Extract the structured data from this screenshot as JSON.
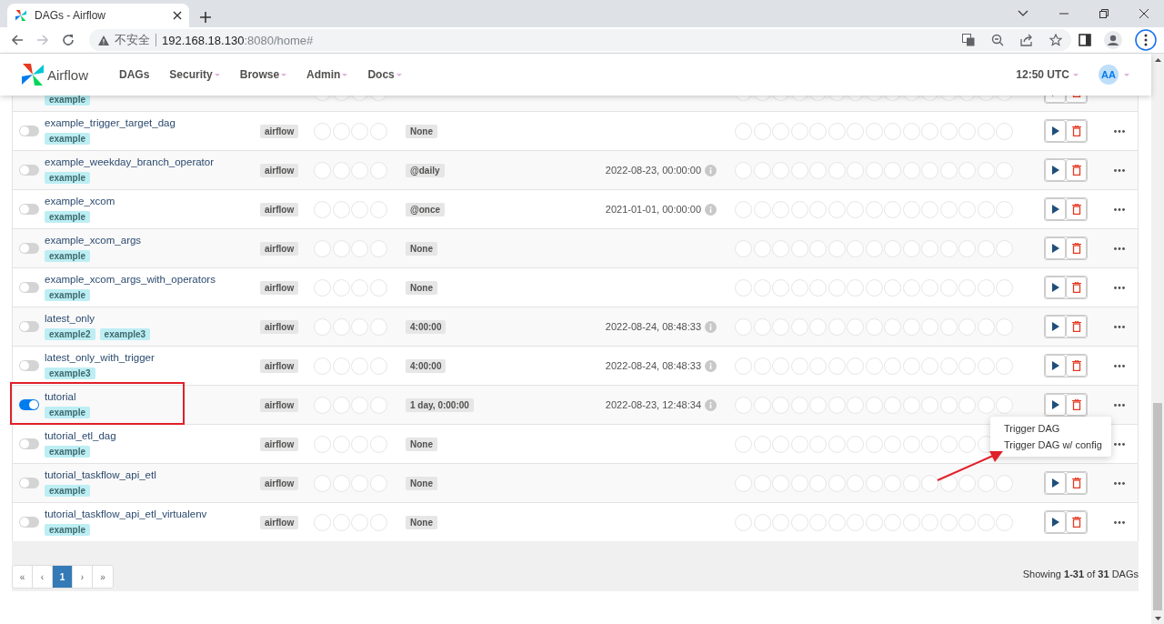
{
  "browser": {
    "tab_title": "DAGs - Airflow",
    "security_label": "不安全",
    "url_host": "192.168.18.130",
    "url_rest": ":8080/home#"
  },
  "navbar": {
    "brand": "Airflow",
    "menu": [
      {
        "label": "DAGs",
        "dropdown": false
      },
      {
        "label": "Security",
        "dropdown": true
      },
      {
        "label": "Browse",
        "dropdown": true
      },
      {
        "label": "Admin",
        "dropdown": true
      },
      {
        "label": "Docs",
        "dropdown": true
      }
    ],
    "time": "12:50 UTC",
    "user_initials": "AA"
  },
  "dags": [
    {
      "tags": [
        "example"
      ]
    },
    {
      "name": "example_trigger_target_dag",
      "tags": [
        "example"
      ],
      "on": false,
      "owner": "airflow",
      "schedule": "None",
      "highlighted": false,
      "menu_open": false
    },
    {
      "name": "example_weekday_branch_operator",
      "tags": [
        "example"
      ],
      "on": false,
      "owner": "airflow",
      "schedule": "@daily",
      "last_run": "2022-08-23, 00:00:00",
      "highlighted": false,
      "menu_open": false
    },
    {
      "name": "example_xcom",
      "tags": [
        "example"
      ],
      "on": false,
      "owner": "airflow",
      "schedule": "@once",
      "last_run": "2021-01-01, 00:00:00",
      "highlighted": false,
      "menu_open": false
    },
    {
      "name": "example_xcom_args",
      "tags": [
        "example"
      ],
      "on": false,
      "owner": "airflow",
      "schedule": "None",
      "highlighted": false,
      "menu_open": false
    },
    {
      "name": "example_xcom_args_with_operators",
      "tags": [
        "example"
      ],
      "on": false,
      "owner": "airflow",
      "schedule": "None",
      "highlighted": false,
      "menu_open": false
    },
    {
      "name": "latest_only",
      "tags": [
        "example2",
        "example3"
      ],
      "on": false,
      "owner": "airflow",
      "schedule": "4:00:00",
      "last_run": "2022-08-24, 08:48:33",
      "highlighted": false,
      "menu_open": false
    },
    {
      "name": "latest_only_with_trigger",
      "tags": [
        "example3"
      ],
      "on": false,
      "owner": "airflow",
      "schedule": "4:00:00",
      "last_run": "2022-08-24, 08:48:33",
      "highlighted": false,
      "menu_open": false
    },
    {
      "name": "tutorial",
      "tags": [
        "example"
      ],
      "on": true,
      "owner": "airflow",
      "schedule": "1 day, 0:00:00",
      "last_run": "2022-08-23, 12:48:34",
      "highlighted": true,
      "menu_open": true
    },
    {
      "name": "tutorial_etl_dag",
      "tags": [
        "example"
      ],
      "on": false,
      "owner": "airflow",
      "schedule": "None",
      "highlighted": false,
      "menu_open": false
    },
    {
      "name": "tutorial_taskflow_api_etl",
      "tags": [
        "example"
      ],
      "on": false,
      "owner": "airflow",
      "schedule": "None",
      "highlighted": false,
      "menu_open": false
    },
    {
      "name": "tutorial_taskflow_api_etl_virtualenv",
      "tags": [
        "example"
      ],
      "on": false,
      "owner": "airflow",
      "schedule": "None",
      "highlighted": false,
      "menu_open": false
    }
  ],
  "trigger_menu": [
    "Trigger DAG",
    "Trigger DAG w/ config"
  ],
  "pagination": [
    {
      "label": "«",
      "selected": false
    },
    {
      "label": "‹",
      "selected": false
    },
    {
      "label": "1",
      "selected": true
    },
    {
      "label": "›",
      "selected": false
    },
    {
      "label": "»",
      "selected": false
    }
  ],
  "summary": "Showing **1-31** of **31** DAGs"
}
